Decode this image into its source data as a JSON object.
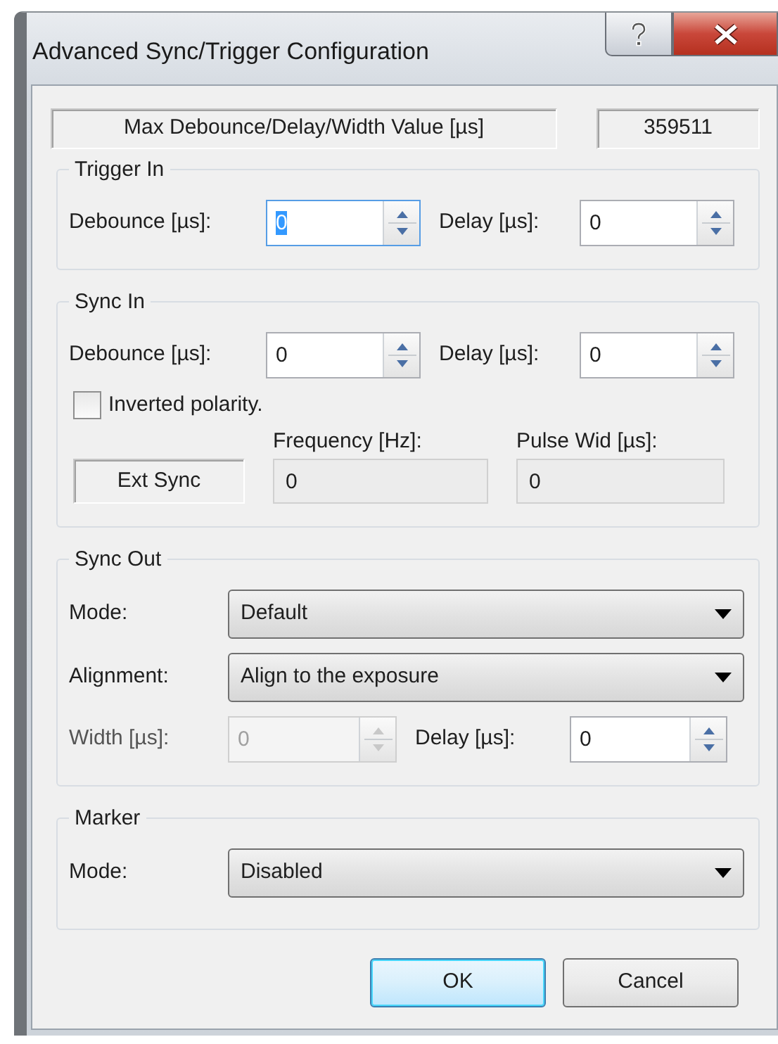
{
  "window": {
    "title": "Advanced Sync/Trigger Configuration"
  },
  "max_value": {
    "label": "Max Debounce/Delay/Width Value [µs]",
    "value": "359511"
  },
  "groups": [
    {
      "title": "Trigger In",
      "rows": [
        {
          "kind": "spins",
          "fields": [
            {
              "label": "Debounce [µs]:",
              "value": "0",
              "focused": true,
              "disabled": false
            },
            {
              "label": "Delay [µs]:",
              "value": "0",
              "focused": false,
              "disabled": false
            }
          ]
        }
      ]
    },
    {
      "title": "Sync In",
      "rows": [
        {
          "kind": "spins",
          "fields": [
            {
              "label": "Debounce [µs]:",
              "value": "0",
              "focused": false,
              "disabled": false
            },
            {
              "label": "Delay [µs]:",
              "value": "0",
              "focused": false,
              "disabled": false
            }
          ]
        },
        {
          "kind": "checkbox",
          "label": "Inverted polarity.",
          "checked": false
        },
        {
          "kind": "readouts",
          "indicator": "Ext Sync",
          "fields": [
            {
              "label": "Frequency [Hz]:",
              "value": "0"
            },
            {
              "label": "Pulse Wid [µs]:",
              "value": "0"
            }
          ]
        }
      ]
    },
    {
      "title": "Sync Out",
      "rows": [
        {
          "kind": "select",
          "label": "Mode:",
          "value": "Default"
        },
        {
          "kind": "select",
          "label": "Alignment:",
          "value": "Align to the exposure"
        },
        {
          "kind": "spins",
          "fields": [
            {
              "label": "Width [µs]:",
              "value": "0",
              "focused": false,
              "disabled": true
            },
            {
              "label": "Delay [µs]:",
              "value": "0",
              "focused": false,
              "disabled": false
            }
          ]
        }
      ]
    },
    {
      "title": "Marker",
      "rows": [
        {
          "kind": "select",
          "label": "Mode:",
          "value": "Disabled"
        }
      ]
    }
  ],
  "buttons": [
    {
      "label": "OK",
      "default": true
    },
    {
      "label": "Cancel",
      "default": false
    }
  ]
}
